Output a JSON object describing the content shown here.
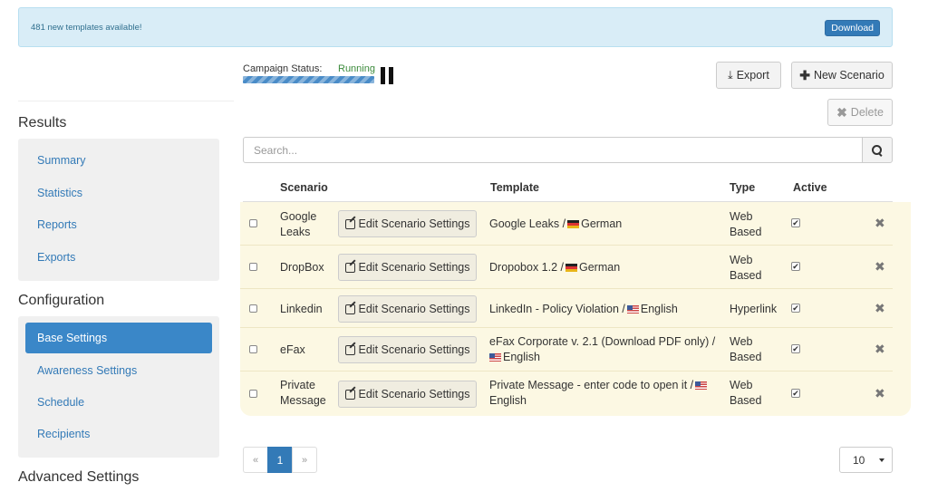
{
  "banner": {
    "text": "481 new templates available!",
    "download_label": "Download"
  },
  "sidebar": {
    "results_heading": "Results",
    "results_items": [
      {
        "label": "Summary"
      },
      {
        "label": "Statistics"
      },
      {
        "label": "Reports"
      },
      {
        "label": "Exports"
      }
    ],
    "configuration_heading": "Configuration",
    "configuration_items": [
      {
        "label": "Base Settings",
        "active": true
      },
      {
        "label": "Awareness Settings"
      },
      {
        "label": "Schedule"
      },
      {
        "label": "Recipients"
      }
    ],
    "advanced_heading": "Advanced Settings"
  },
  "campaign": {
    "status_label": "Campaign Status:",
    "status_value": "Running"
  },
  "toolbar": {
    "export_label": "Export",
    "new_scenario_label": "New Scenario",
    "delete_label": "Delete"
  },
  "search": {
    "placeholder": "Search..."
  },
  "table": {
    "headers": {
      "scenario": "Scenario",
      "template": "Template",
      "type": "Type",
      "active": "Active"
    },
    "edit_label": "Edit Scenario Settings",
    "rows": [
      {
        "name_l1": "Google",
        "name_l2": "Leaks",
        "tpl_l1": "Google Leaks /",
        "tpl_lang": "German",
        "type_l1": "Web",
        "type_l2": "Based",
        "active": true
      },
      {
        "name_l1": "DropBox",
        "name_l2": "",
        "tpl_l1": "Dropobox 1.2 /",
        "tpl_lang": "German",
        "type_l1": "Web",
        "type_l2": "Based",
        "active": true
      },
      {
        "name_l1": "Linkedin",
        "name_l2": "",
        "tpl_l1": "LinkedIn - Policy Violation /",
        "tpl_lang": "English",
        "type_l1": "Hyperlink",
        "type_l2": "",
        "active": true
      },
      {
        "name_l1": "eFax",
        "name_l2": "",
        "tpl_l1": "eFax Corporate v. 2.1 (Download PDF only) /",
        "tpl_lang": "English",
        "type_l1": "Web",
        "type_l2": "Based",
        "active": true
      },
      {
        "name_l1": "Private",
        "name_l2": "Message",
        "tpl_l1": "Private Message - enter code to open it /",
        "tpl_lang": "English",
        "type_l1": "Web",
        "type_l2": "Based",
        "active": true
      }
    ]
  },
  "pagination": {
    "prev": "«",
    "current": "1",
    "next": "»"
  },
  "per_page": {
    "value": "10"
  },
  "colors": {
    "primary": "#337ab7",
    "banner_bg": "#d9edf7",
    "row_highlight": "#fcf8e3",
    "running": "#3c8b3c"
  },
  "icons": {
    "export": "export-icon",
    "new": "plus-icon",
    "delete": "x-icon",
    "search": "search-icon",
    "edit": "edit-icon",
    "status": "pause-icon"
  }
}
